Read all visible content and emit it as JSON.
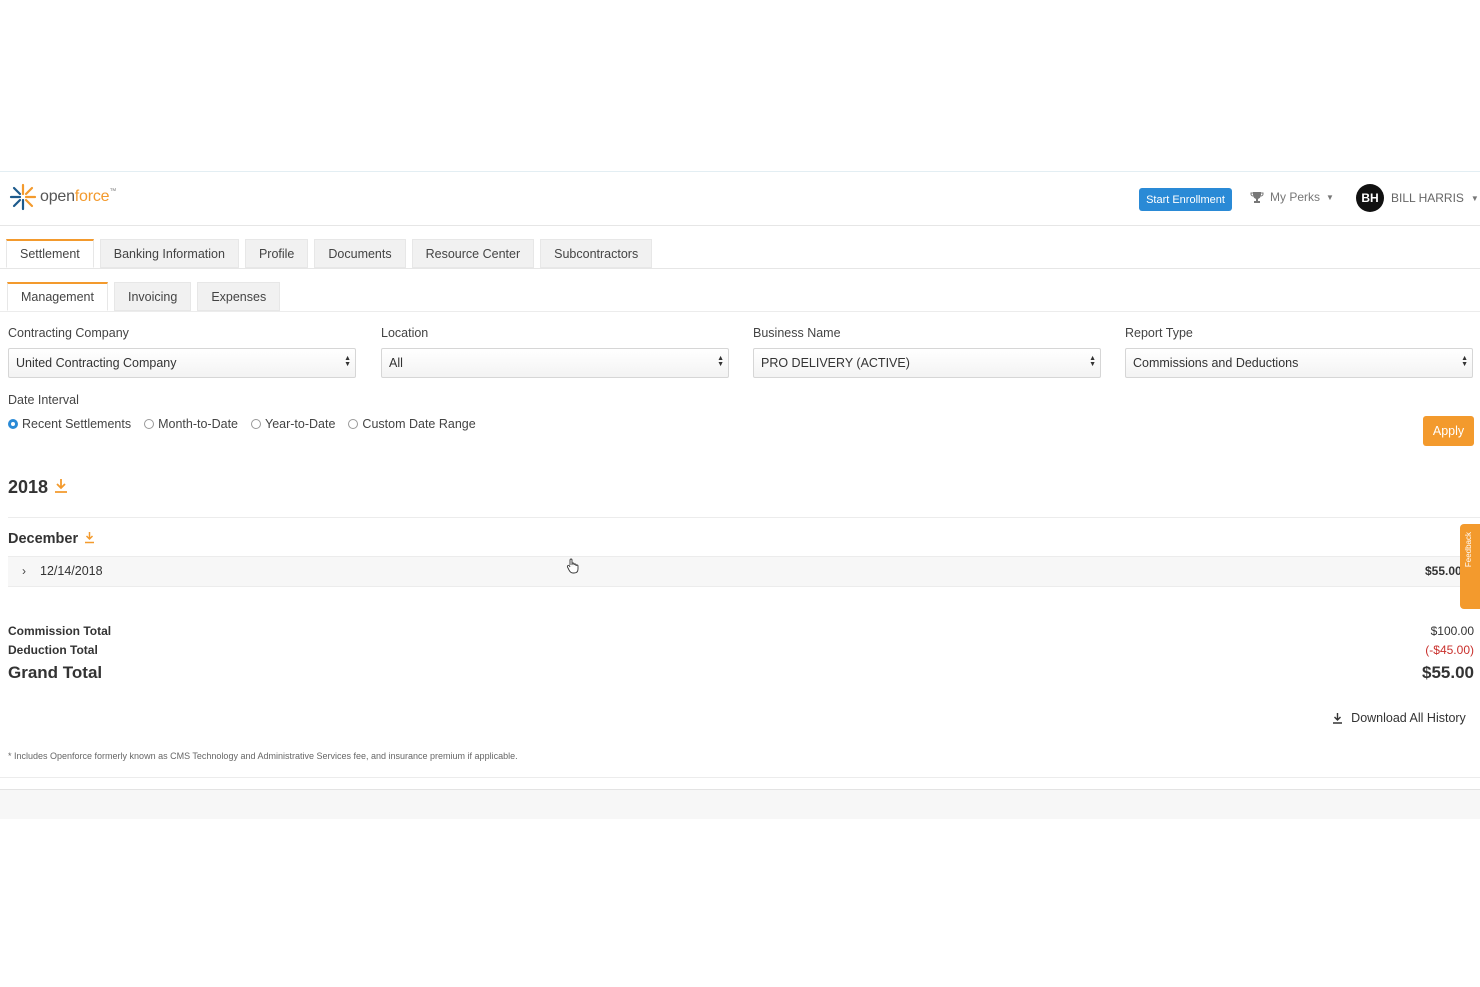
{
  "brand": {
    "logo_prefix": "open",
    "logo_suffix": "force",
    "logo_tm": "™"
  },
  "header": {
    "start_enrollment": "Start Enrollment",
    "my_perks": "My Perks",
    "user_initials": "BH",
    "user_name": "BILL HARRIS"
  },
  "tabs": [
    "Settlement",
    "Banking Information",
    "Profile",
    "Documents",
    "Resource Center",
    "Subcontractors"
  ],
  "subtabs": [
    "Management",
    "Invoicing",
    "Expenses"
  ],
  "filters": {
    "contracting_company": {
      "label": "Contracting Company",
      "value": "United Contracting Company"
    },
    "location": {
      "label": "Location",
      "value": "All"
    },
    "business_name": {
      "label": "Business Name",
      "value": "PRO DELIVERY (ACTIVE)"
    },
    "report_type": {
      "label": "Report Type",
      "value": "Commissions and Deductions"
    }
  },
  "date_interval": {
    "label": "Date Interval",
    "options": [
      "Recent Settlements",
      "Month-to-Date",
      "Year-to-Date",
      "Custom Date Range"
    ],
    "selected": "Recent Settlements"
  },
  "apply_label": "Apply",
  "report": {
    "year": "2018",
    "month": "December",
    "rows": [
      {
        "date": "12/14/2018",
        "amount": "$55.00"
      }
    ]
  },
  "totals": {
    "commission_label": "Commission Total",
    "commission_value": "$100.00",
    "deduction_label": "Deduction Total",
    "deduction_value": "(-$45.00)",
    "grand_label": "Grand Total",
    "grand_value": "$55.00"
  },
  "download_all": "Download All History",
  "footnote": "* Includes Openforce formerly known as CMS Technology and Administrative Services fee, and insurance premium if applicable.",
  "feedback_label": "Feedback",
  "colors": {
    "accent": "#f39a2d",
    "primary": "#2a8ad6",
    "negative": "#c9302c"
  },
  "icons": [
    "openforce-logo-icon",
    "trophy-icon",
    "download-icon",
    "chevron-right-icon",
    "pointer-cursor-icon"
  ]
}
